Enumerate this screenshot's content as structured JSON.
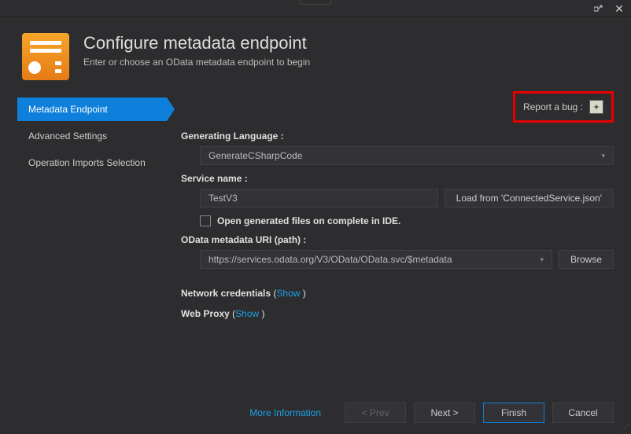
{
  "header": {
    "title": "Configure metadata endpoint",
    "subtitle": "Enter or choose an OData metadata endpoint to begin"
  },
  "sidebar": {
    "items": [
      {
        "label": "Metadata Endpoint",
        "active": true
      },
      {
        "label": "Advanced Settings",
        "active": false
      },
      {
        "label": "Operation Imports Selection",
        "active": false
      }
    ]
  },
  "report": {
    "label": "Report a bug :"
  },
  "form": {
    "lang_label": "Generating Language :",
    "lang_value": "GenerateCSharpCode",
    "service_label": "Service name :",
    "service_value": "TestV3",
    "load_btn": "Load from 'ConnectedService.json'",
    "open_files_label": "Open generated files on complete in IDE.",
    "uri_label": "OData metadata URI (path) :",
    "uri_value": "https://services.odata.org/V3/OData/OData.svc/$metadata",
    "browse_btn": "Browse",
    "net_cred_label": "Network credentials",
    "show_link": "Show",
    "proxy_label": "Web Proxy"
  },
  "footer": {
    "more": "More Information",
    "prev": "< Prev",
    "next": "Next >",
    "finish": "Finish",
    "cancel": "Cancel"
  }
}
